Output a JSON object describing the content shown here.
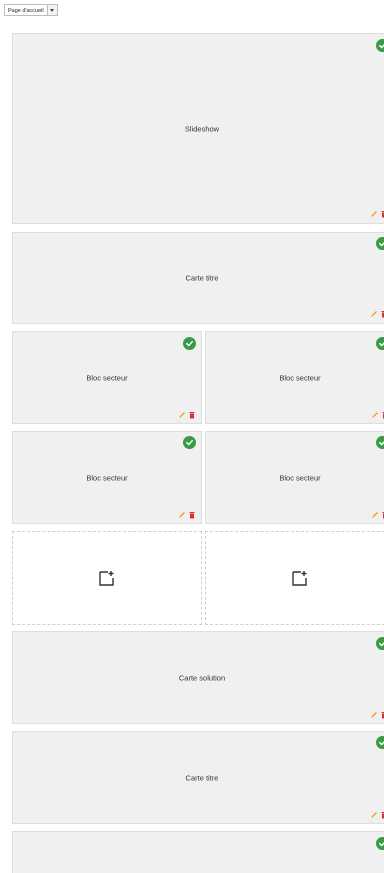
{
  "page_selector": {
    "value": "Page d'accueil"
  },
  "blocks": [
    {
      "label": "Slideshow",
      "status": "check-circle-icon"
    },
    {
      "label": "Carte titre",
      "status": "check-circle-icon"
    },
    {
      "label": "Bloc secteur",
      "status": "check-circle-icon"
    },
    {
      "label": "Bloc secteur",
      "status": "check-circle-icon"
    },
    {
      "label": "Bloc secteur",
      "status": "check-circle-icon"
    },
    {
      "label": "Bloc secteur",
      "status": "check-circle-icon"
    },
    {
      "label": "Carte solution",
      "status": "check-circle-icon"
    },
    {
      "label": "Carte titre",
      "status": "check-circle-icon"
    },
    {
      "label": "",
      "status": "check-circle-icon"
    }
  ],
  "empty_slots": [
    {
      "icon": "add-page-icon"
    },
    {
      "icon": "add-page-icon"
    }
  ],
  "colors": {
    "check": "#3a9b45",
    "edit": "#f0a020",
    "delete": "#d83030",
    "block_bg": "#f0f0f0"
  }
}
